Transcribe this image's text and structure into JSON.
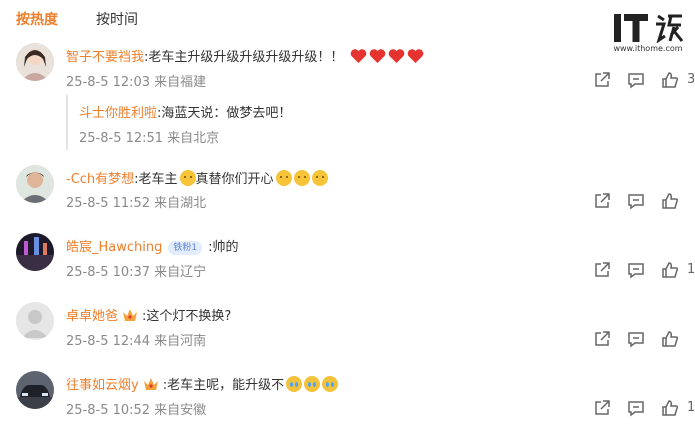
{
  "tabs": [
    {
      "label": "按热度",
      "active": true
    },
    {
      "label": "按时间",
      "active": false
    }
  ],
  "logo": {
    "mark_text": "IT之家",
    "url_text": "www.ithome.com"
  },
  "colors": {
    "accent": "#ee7f2d",
    "meta": "#8a8a8a"
  },
  "comments": [
    {
      "user": "智子不要裆我",
      "text": ":老车主升级升级升级升级升级！！",
      "emojis": [
        "heart",
        "heart",
        "heart",
        "heart"
      ],
      "time": "25-8-5 12:03",
      "location": "来自福建",
      "likes": "3",
      "reply": {
        "user": "斗士你胜利啦",
        "text": ":海蓝天说：做梦去吧！",
        "time": "25-8-5 12:51",
        "location": "来自北京"
      }
    },
    {
      "user": "-Cch有梦想",
      "text_a": ":老车主",
      "text_b": "真替你们开心",
      "time": "25-8-5 11:52",
      "location": "来自湖北",
      "likes": ""
    },
    {
      "user": "皓宸_Hawching",
      "badge": "铁粉1",
      "text": ":帅的",
      "time": "25-8-5 10:37",
      "location": "来自辽宁",
      "likes": "1"
    },
    {
      "user": "卓卓她爸",
      "text": ":这个灯不换换?",
      "time": "25-8-5 12:44",
      "location": "来自河南",
      "likes": ""
    },
    {
      "user": "往事如云烟y",
      "text": ":老车主呢，能升级不",
      "time": "25-8-5 10:52",
      "location": "来自安徽",
      "likes": "1"
    }
  ]
}
